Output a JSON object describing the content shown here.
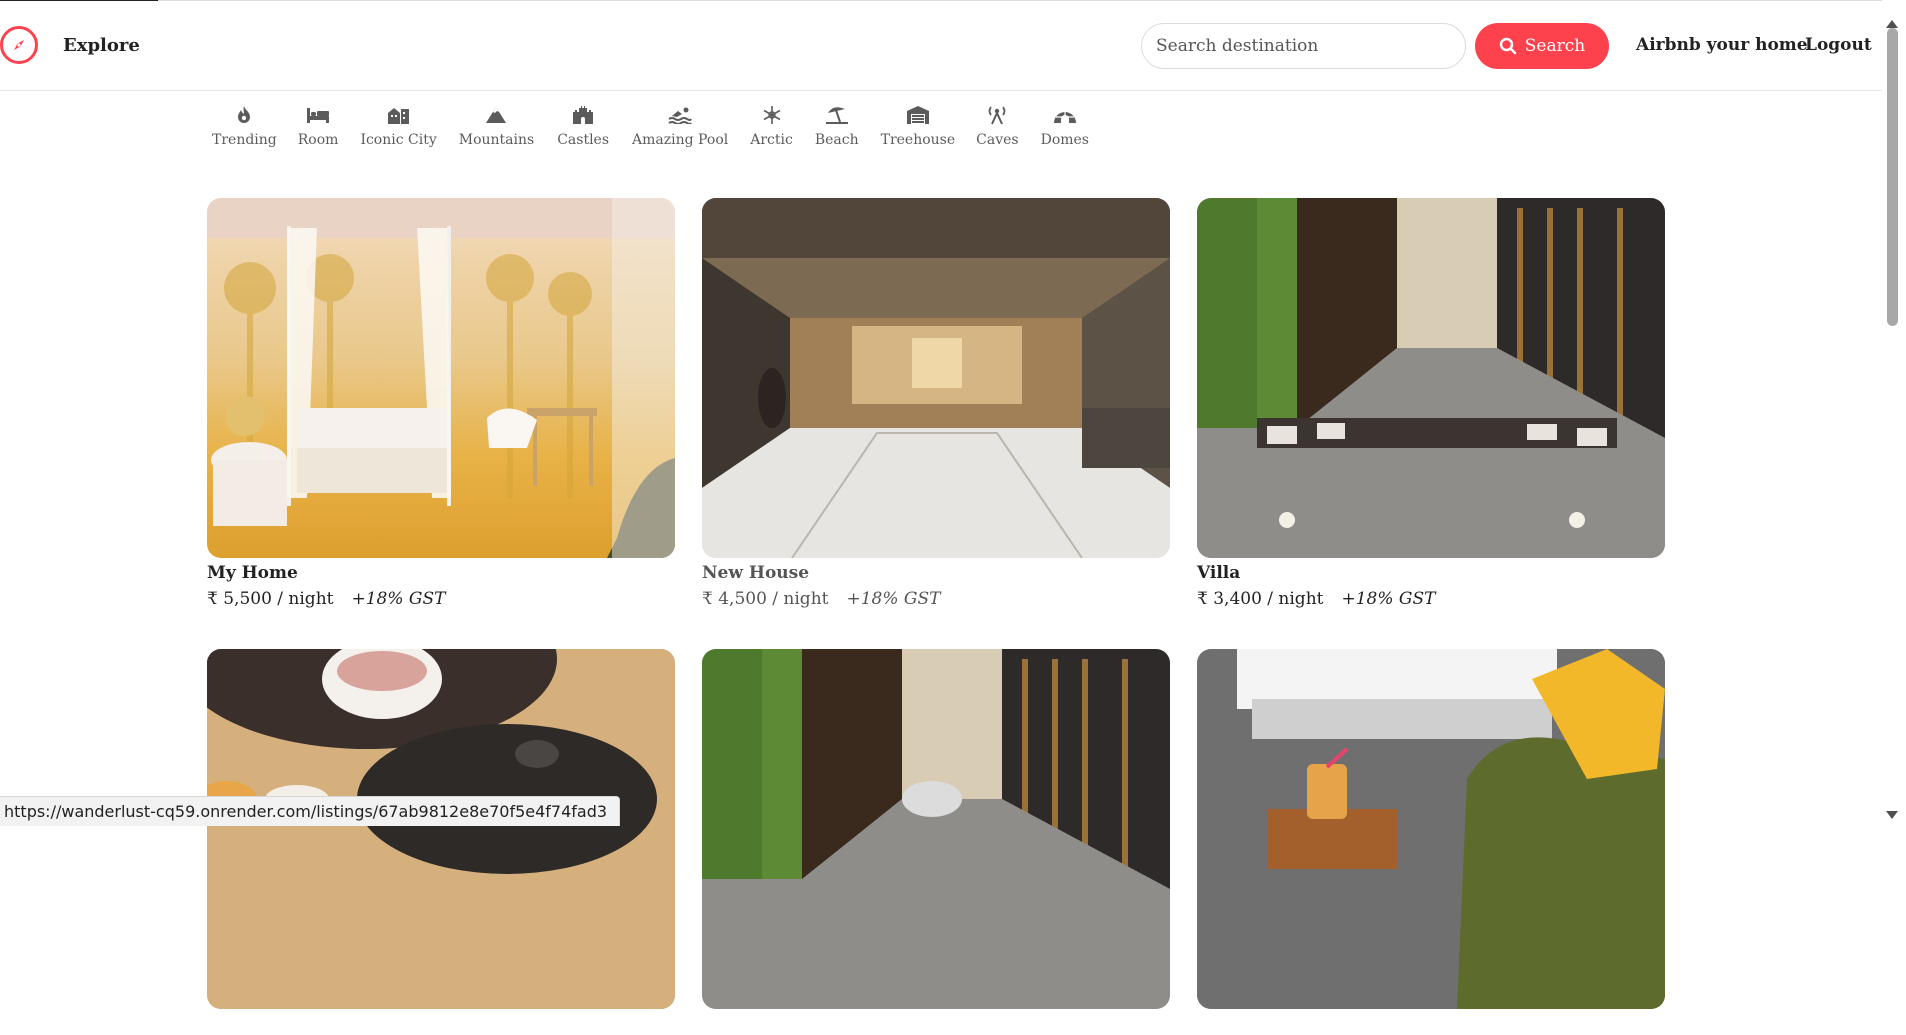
{
  "nav": {
    "explore_label": "Explore",
    "search_placeholder": "Search destination",
    "search_button_label": "Search",
    "host_label": "Airbnb your home",
    "logout_label": "Logout",
    "brand_color": "#fe424d"
  },
  "filters": [
    {
      "label": "Trending",
      "icon": "fire-icon"
    },
    {
      "label": "Room",
      "icon": "bed-icon"
    },
    {
      "label": "Iconic City",
      "icon": "city-icon"
    },
    {
      "label": "Mountains",
      "icon": "mountain-icon"
    },
    {
      "label": "Castles",
      "icon": "castle-icon"
    },
    {
      "label": "Amazing Pool",
      "icon": "swimmer-icon"
    },
    {
      "label": "Arctic",
      "icon": "snowflake-icon"
    },
    {
      "label": "Beach",
      "icon": "umbrella-beach-icon"
    },
    {
      "label": "Treehouse",
      "icon": "warehouse-icon"
    },
    {
      "label": "Caves",
      "icon": "tower-broadcast-icon"
    },
    {
      "label": "Domes",
      "icon": "igloo-icon"
    }
  ],
  "listings": [
    {
      "title": "My Home",
      "price": "₹ 5,500 / night",
      "gst": "+18% GST"
    },
    {
      "title": "New House",
      "price": "₹ 4,500 / night",
      "gst": "+18% GST"
    },
    {
      "title": "Villa",
      "price": "₹ 3,400 / night",
      "gst": "+18% GST"
    },
    {
      "title": "",
      "price": "",
      "gst": ""
    },
    {
      "title": "",
      "price": "",
      "gst": ""
    },
    {
      "title": "",
      "price": "",
      "gst": ""
    }
  ],
  "status_url": "https://wanderlust-cq59.onrender.com/listings/67ab9812e8e70f5e4f74fad3"
}
